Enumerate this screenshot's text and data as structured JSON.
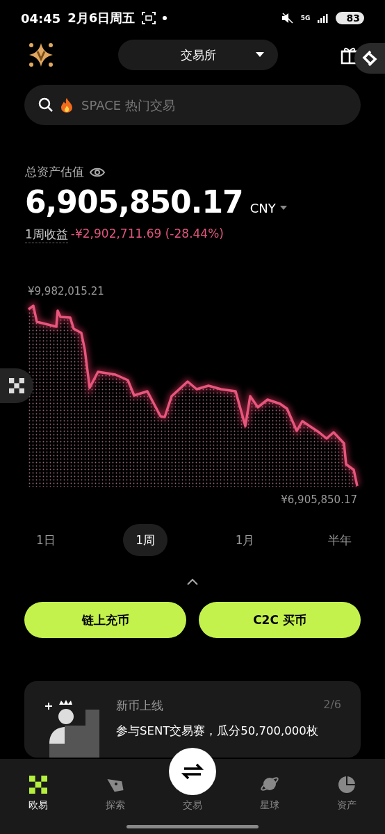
{
  "status_bar": {
    "time": "04:45",
    "date": "2月6日周五",
    "network": "5G",
    "battery": "83"
  },
  "header": {
    "mode": "交易所"
  },
  "search": {
    "placeholder": "SPACE 热门交易"
  },
  "assets": {
    "label": "总资产估值",
    "amount": "6,905,850.17",
    "currency": "CNY",
    "pnl_label": "1周收益",
    "pnl_value": "-¥2,902,711.69 (-28.44%)"
  },
  "chart": {
    "max_label": "¥9,982,015.21",
    "min_label": "¥6,905,850.17"
  },
  "periods": [
    {
      "label": "1日",
      "selected": false
    },
    {
      "label": "1周",
      "selected": true
    },
    {
      "label": "1月",
      "selected": false
    },
    {
      "label": "半年",
      "selected": false
    }
  ],
  "actions": [
    "链上充币",
    "C2C 买币"
  ],
  "promo": {
    "title": "新币上线",
    "counter": "2/6",
    "text": "参与SENT交易赛，瓜分50,700,000枚"
  },
  "nav": [
    {
      "label": "欧易",
      "kind": "home",
      "selected": true
    },
    {
      "label": "探索",
      "kind": "explore",
      "selected": false
    },
    {
      "label": "交易",
      "kind": "trade",
      "selected": false
    },
    {
      "label": "星球",
      "kind": "planet",
      "selected": false
    },
    {
      "label": "资产",
      "kind": "assets",
      "selected": false
    }
  ]
}
